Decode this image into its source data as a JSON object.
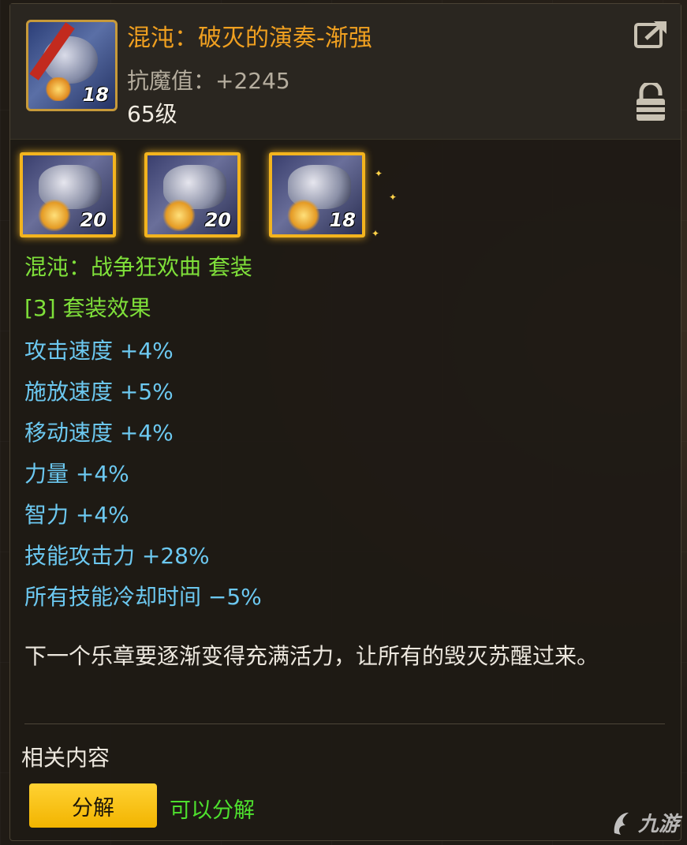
{
  "item": {
    "name": "混沌：破灭的演奏-渐强",
    "stat": "抗魔值：+2245",
    "level": "65级",
    "icon_number": "18"
  },
  "set": {
    "icons": [
      {
        "number": "20"
      },
      {
        "number": "20"
      },
      {
        "number": "18"
      }
    ],
    "name": "混沌：战争狂欢曲 套装",
    "effect_header": "[3] 套装效果",
    "bonuses": [
      "攻击速度 +4%",
      "施放速度 +5%",
      "移动速度 +4%",
      "力量 +4%",
      "智力 +4%",
      "技能攻击力 +28%",
      "所有技能冷却时间 −5%"
    ]
  },
  "description": "下一个乐章要逐渐变得充满活力，让所有的毁灭苏醒过来。",
  "related_label": "相关内容",
  "actions": {
    "decompose_label": "分解",
    "decompose_status": "可以分解"
  },
  "watermark": "九游",
  "colors": {
    "title": "#f0a020",
    "set_green": "#7fe03a",
    "bonus_blue": "#6cc8f0",
    "button_yellow": "#f2b400",
    "status_green": "#4ee02e"
  },
  "icons": {
    "share": "share-external-icon",
    "lock": "unlocked-padlock-icon"
  }
}
